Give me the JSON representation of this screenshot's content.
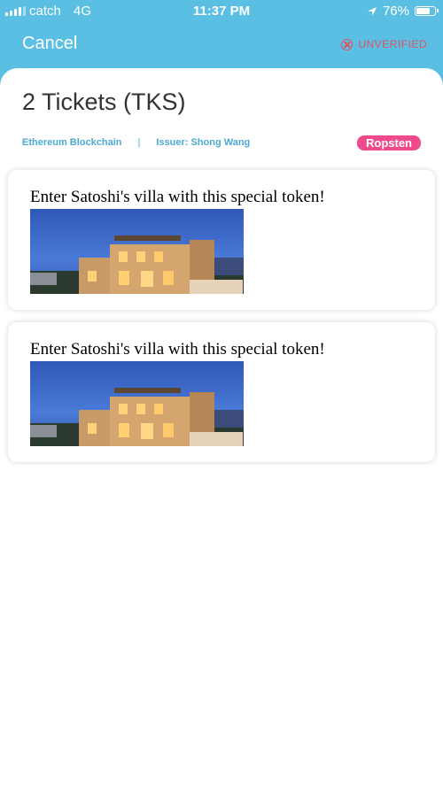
{
  "status_bar": {
    "carrier": "catch",
    "network": "4G",
    "time": "11:37 PM",
    "battery": "76%",
    "battery_level": 0.76
  },
  "header": {
    "cancel_label": "Cancel",
    "unverified_label": "UNVERIFIED",
    "bar_color": "#5bbfe3"
  },
  "token": {
    "title": "2 Tickets (TKS)",
    "blockchain": "Ethereum Blockchain",
    "separator": "|",
    "issuer": "Issuer: Shong Wang",
    "network_badge": "Ropsten",
    "badge_color": "#ef4a8c"
  },
  "tickets": [
    {
      "text": "Enter Satoshi's villa with this special token!"
    },
    {
      "text": "Enter Satoshi's villa with this special token!"
    }
  ]
}
